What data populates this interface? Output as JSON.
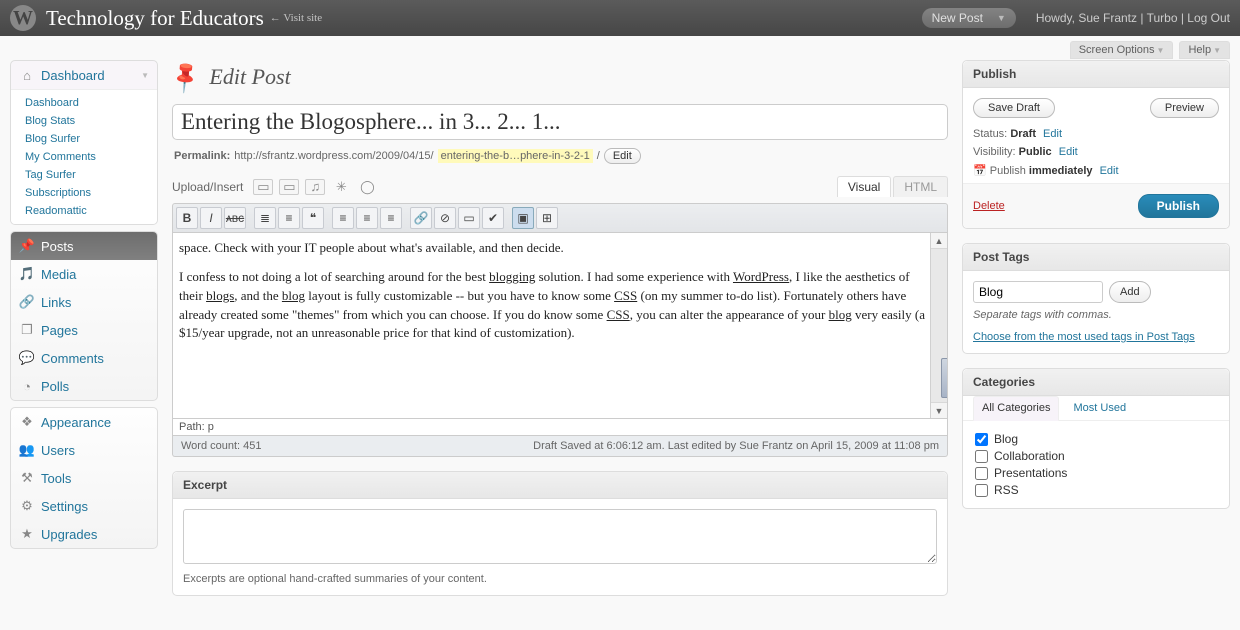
{
  "header": {
    "site_title": "Technology for Educators",
    "visit_site": "← Visit site",
    "new_post": "New Post",
    "howdy_prefix": "Howdy, ",
    "user": "Sue Frantz",
    "turbo": "Turbo",
    "logout": "Log Out"
  },
  "subheader": {
    "screen_options": "Screen Options",
    "help": "Help"
  },
  "menu": {
    "dashboard": {
      "label": "Dashboard",
      "sub": [
        "Dashboard",
        "Blog Stats",
        "Blog Surfer",
        "My Comments",
        "Tag Surfer",
        "Subscriptions",
        "Readomattic"
      ]
    },
    "main": [
      {
        "label": "Posts",
        "icon": "✎",
        "current": true
      },
      {
        "label": "Media",
        "icon": "▦"
      },
      {
        "label": "Links",
        "icon": "🔗"
      },
      {
        "label": "Pages",
        "icon": "❐"
      },
      {
        "label": "Comments",
        "icon": "💬"
      },
      {
        "label": "Polls",
        "icon": "◔"
      }
    ],
    "bottom": [
      {
        "label": "Appearance",
        "icon": "❖"
      },
      {
        "label": "Users",
        "icon": "👥"
      },
      {
        "label": "Tools",
        "icon": "⚒"
      },
      {
        "label": "Settings",
        "icon": "⚙"
      },
      {
        "label": "Upgrades",
        "icon": "★"
      }
    ]
  },
  "page": {
    "heading": "Edit Post",
    "title_value": "Entering the Blogosphere... in 3... 2... 1...",
    "permalink_label": "Permalink:",
    "permalink_base": "http://sfrantz.wordpress.com/2009/04/15/",
    "permalink_slug": "entering-the-b…phere-in-3-2-1",
    "permalink_edit": "Edit",
    "upload_insert": "Upload/Insert",
    "tabs": {
      "visual": "Visual",
      "html": "HTML"
    },
    "content_p1": "space.  Check with your IT people about what's available, and then decide.",
    "content_p2_a": "I confess to not doing a lot of searching around for the best ",
    "content_p2_link1": "blogging",
    "content_p2_b": " solution.  I had some experience with ",
    "content_p2_link2": "WordPress",
    "content_p2_c": ", I like the aesthetics of their ",
    "content_p2_link3": "blogs",
    "content_p2_d": ", and the ",
    "content_p2_link4": "blog",
    "content_p2_e": " layout is fully customizable -- but you have to know some ",
    "content_p2_link5": "CSS",
    "content_p2_f": " (on my summer to-do list). Fortunately others have already created some \"themes\" from which you can choose.  If you do know some ",
    "content_p2_link6": "CSS",
    "content_p2_g": ", you can alter the appearance of your ",
    "content_p2_link7": "blog",
    "content_p2_h": " very easily (a $15/year upgrade, not an unreasonable price for that kind of customization).",
    "path": "Path: p",
    "wordcount": "Word count: 451",
    "autosave": "Draft Saved at 6:06:12 am. Last edited by Sue Frantz on April 15, 2009 at 11:08 pm"
  },
  "publish": {
    "heading": "Publish",
    "save_draft": "Save Draft",
    "preview": "Preview",
    "status_label": "Status:",
    "status_value": "Draft",
    "vis_label": "Visibility:",
    "vis_value": "Public",
    "pub_label": "Publish",
    "pub_value": "immediately",
    "edit": "Edit",
    "delete": "Delete",
    "publish_btn": "Publish"
  },
  "tags": {
    "heading": "Post Tags",
    "value": "Blog",
    "add": "Add",
    "hint": "Separate tags with commas.",
    "choose": "Choose from the most used tags in Post Tags"
  },
  "categories": {
    "heading": "Categories",
    "tab_all": "All Categories",
    "tab_most": "Most Used",
    "items": [
      {
        "label": "Blog",
        "checked": true
      },
      {
        "label": "Collaboration",
        "checked": false
      },
      {
        "label": "Presentations",
        "checked": false
      },
      {
        "label": "RSS",
        "checked": false
      }
    ]
  },
  "excerpt": {
    "heading": "Excerpt",
    "hint": "Excerpts are optional hand-crafted summaries of your content."
  }
}
